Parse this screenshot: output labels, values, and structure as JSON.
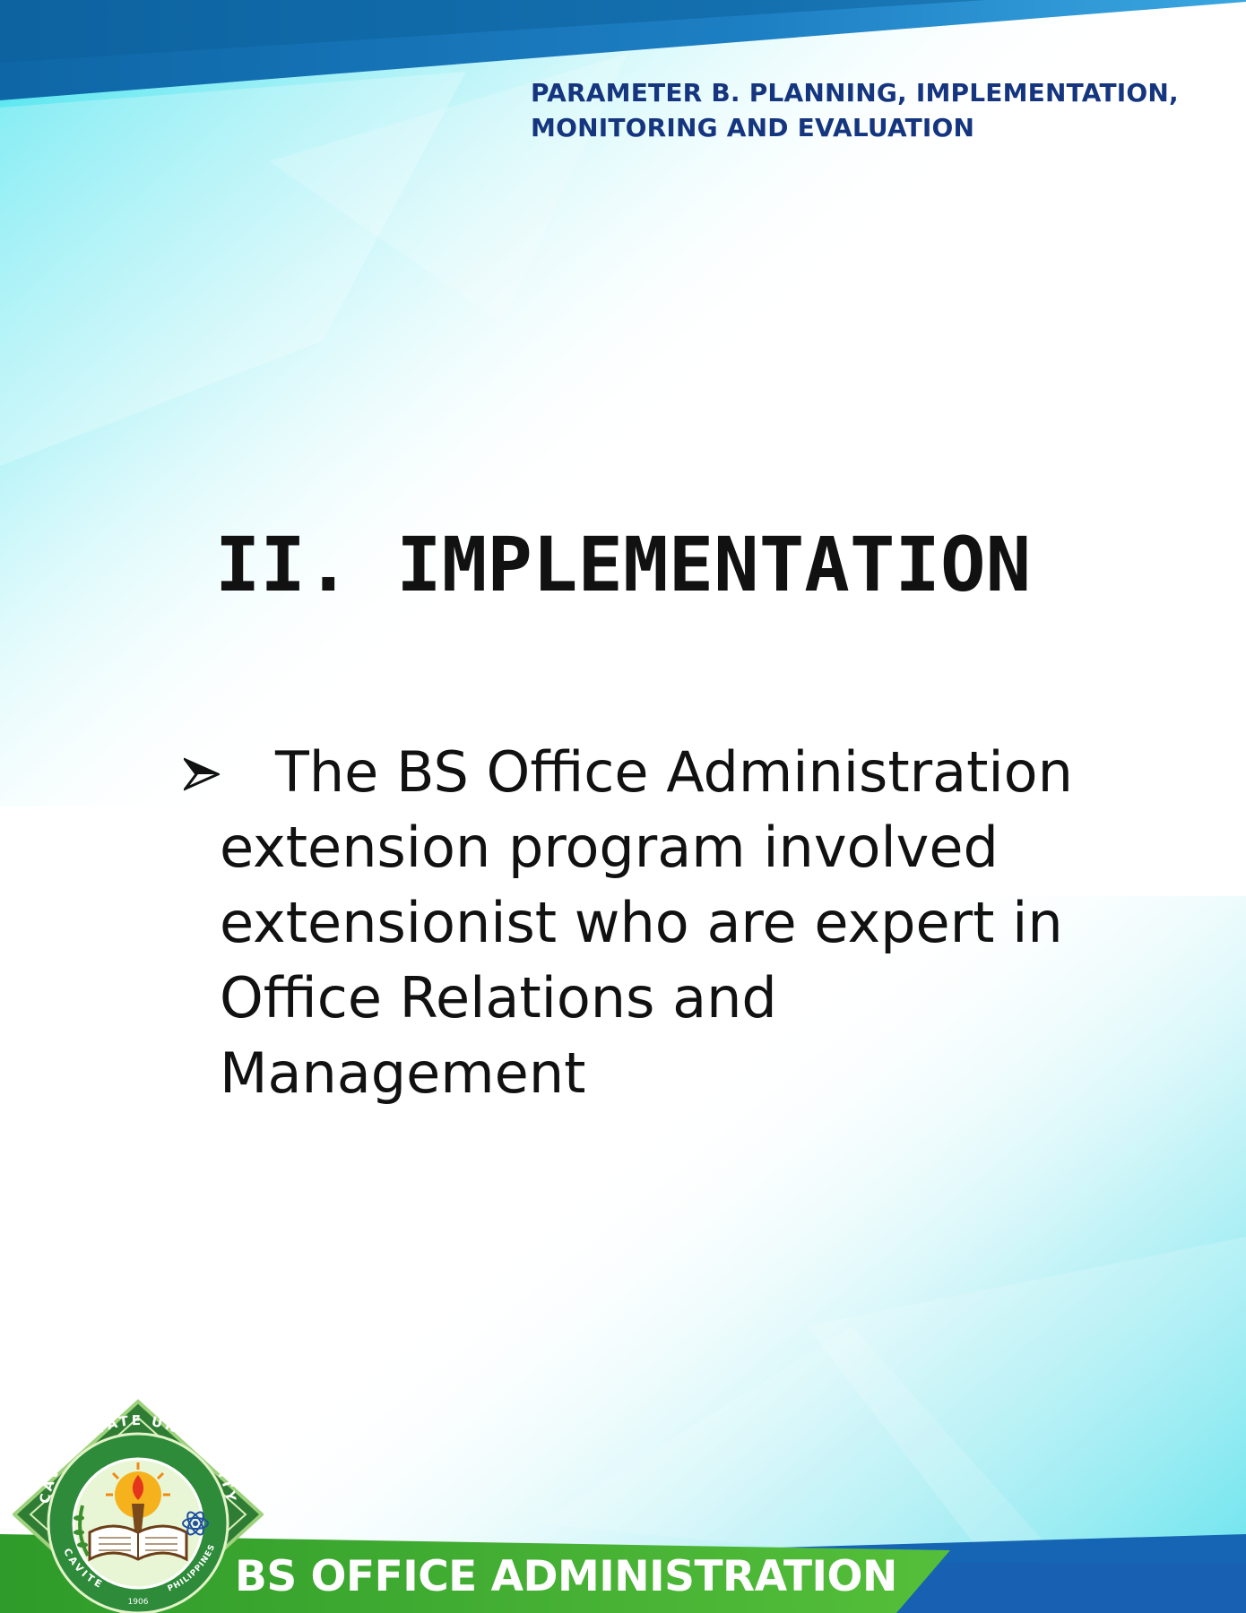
{
  "header": {
    "parameter_line1": "PARAMETER B. PLANNING, IMPLEMENTATION,",
    "parameter_line2": "MONITORING AND EVALUATION"
  },
  "section": {
    "title": "II.  IMPLEMENTATION"
  },
  "bullet": {
    "icon": "arrowhead-bullet-icon",
    "lines": [
      "The BS Office Administration",
      "extension program involved",
      "extensionist who are expert in",
      "Office Relations and",
      "Management"
    ]
  },
  "footer": {
    "title": "BS OFFICE ADMINISTRATION",
    "logo_ring_text": "CAVITE STATE UNIVERSITY",
    "logo_bottom_left": "CAVITE",
    "logo_bottom_right": "PHILIPPINES",
    "logo_year": "1906"
  },
  "colors": {
    "header_text": "#15357f",
    "top_band": "#1168b3",
    "teal": "#3fe0ec",
    "footer_green": "#3fae2e",
    "footer_blue": "#1664b4"
  }
}
